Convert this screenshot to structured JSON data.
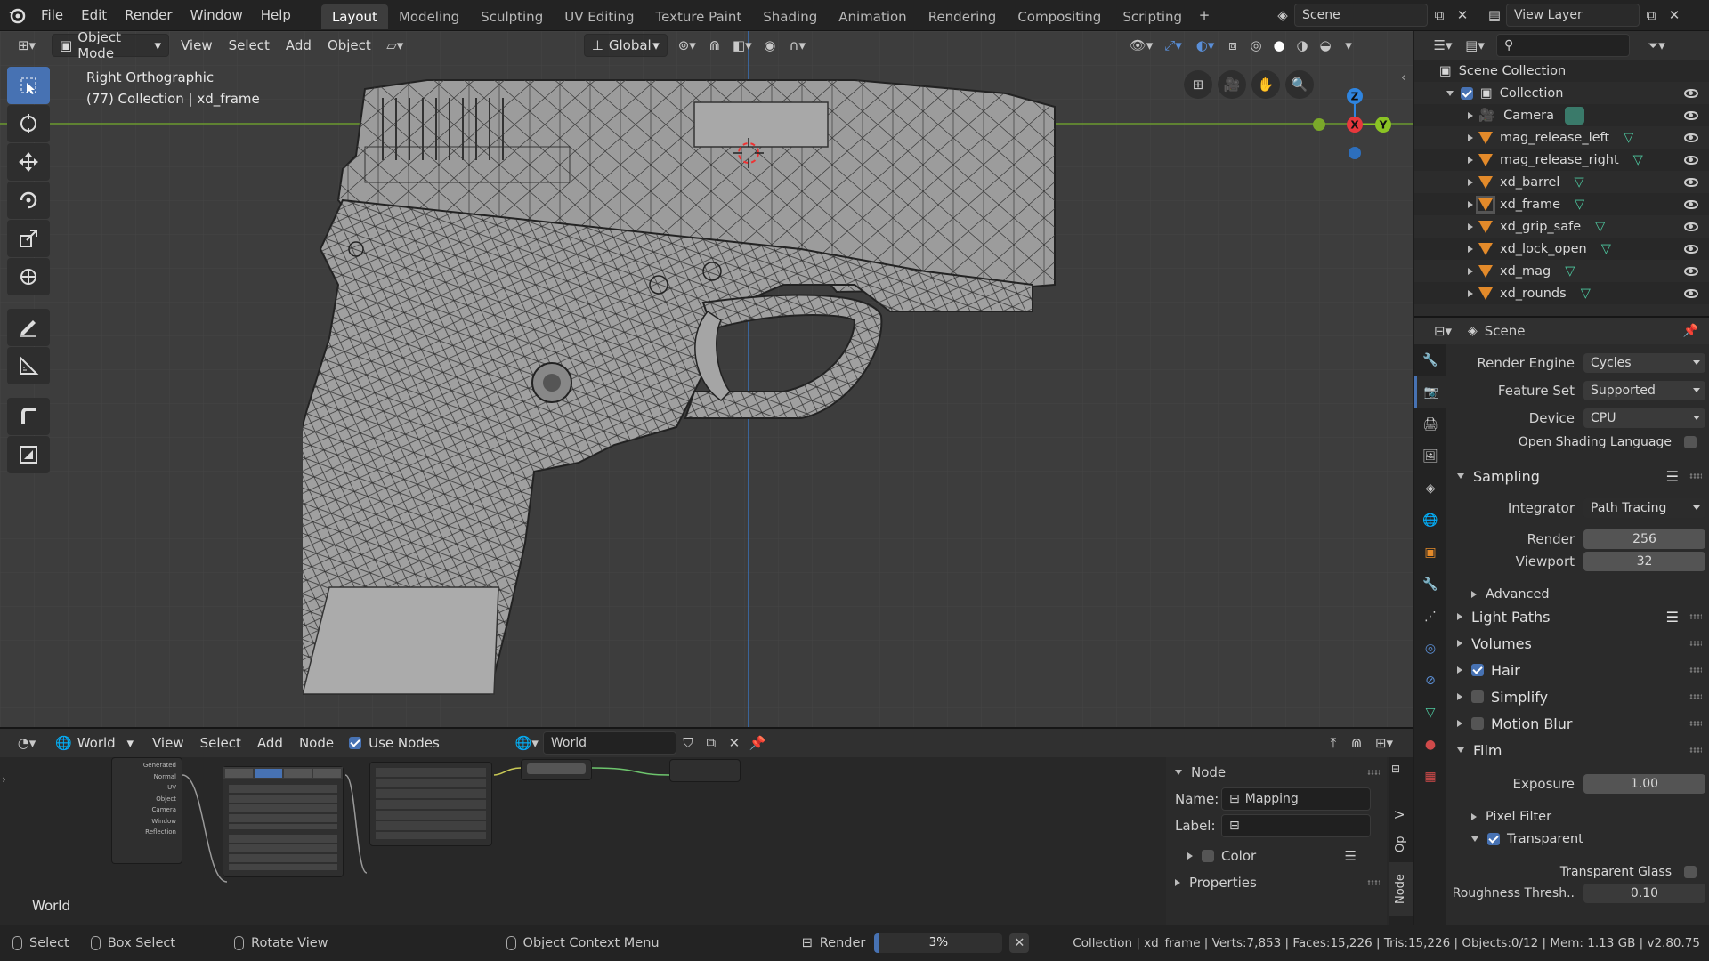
{
  "topbar": {
    "menus": [
      "File",
      "Edit",
      "Render",
      "Window",
      "Help"
    ],
    "workspaces": [
      "Layout",
      "Modeling",
      "Sculpting",
      "UV Editing",
      "Texture Paint",
      "Shading",
      "Animation",
      "Rendering",
      "Compositing",
      "Scripting"
    ],
    "active_workspace": "Layout",
    "scene_name": "Scene",
    "view_layer": "View Layer"
  },
  "viewport": {
    "mode": "Object Mode",
    "menus": [
      "View",
      "Select",
      "Add",
      "Object"
    ],
    "orientation": "Global",
    "view_name": "Right Orthographic",
    "collection_info": "(77) Collection | xd_frame",
    "gizmo_axes": {
      "z": "Z",
      "x": "X",
      "y": "Y"
    }
  },
  "node_editor": {
    "type": "World",
    "menus": [
      "View",
      "Select",
      "Add",
      "Node"
    ],
    "use_nodes_label": "Use Nodes",
    "world_name": "World",
    "corner_label": "World",
    "panel": {
      "title": "Node",
      "name_label": "Name:",
      "name_value": "Mapping",
      "label_label": "Label:",
      "label_value": "",
      "color_label": "Color",
      "properties_label": "Properties"
    },
    "side_tabs": [
      "Node",
      "Op",
      "V"
    ]
  },
  "outliner": {
    "root": "Scene Collection",
    "collection": "Collection",
    "items": [
      "Camera",
      "mag_release_left",
      "mag_release_right",
      "xd_barrel",
      "xd_frame",
      "xd_grip_safe",
      "xd_lock_open",
      "xd_mag",
      "xd_rounds"
    ]
  },
  "properties": {
    "context": "Scene",
    "render_engine_label": "Render Engine",
    "render_engine": "Cycles",
    "feature_set_label": "Feature Set",
    "feature_set": "Supported",
    "device_label": "Device",
    "device": "CPU",
    "osl_label": "Open Shading Language",
    "sampling_label": "Sampling",
    "integrator_label": "Integrator",
    "integrator": "Path Tracing",
    "render_label": "Render",
    "render_samples": "256",
    "viewport_label": "Viewport",
    "viewport_samples": "32",
    "advanced_label": "Advanced",
    "light_paths_label": "Light Paths",
    "volumes_label": "Volumes",
    "hair_label": "Hair",
    "simplify_label": "Simplify",
    "motion_blur_label": "Motion Blur",
    "film_label": "Film",
    "exposure_label": "Exposure",
    "exposure": "1.00",
    "pixel_filter_label": "Pixel Filter",
    "transparent_label": "Transparent",
    "transparent_glass_label": "Transparent Glass",
    "roughness_label": "Roughness Thresh..",
    "roughness": "0.10"
  },
  "status": {
    "select": "Select",
    "box_select": "Box Select",
    "rotate_view": "Rotate View",
    "context_menu": "Object Context Menu",
    "render_label": "Render",
    "render_progress": "3%",
    "render_progress_value": 0.03,
    "stats": "Collection | xd_frame | Verts:7,853 | Faces:15,226 | Tris:15,226 | Objects:0/12 | Mem: 1.13 GB | v2.80.75"
  },
  "colors": {
    "accent": "#4772b3",
    "mesh_icon": "#e38a2a",
    "x_axis": "#e8383d",
    "y_axis": "#8bc424",
    "z_axis": "#2f85e0"
  }
}
